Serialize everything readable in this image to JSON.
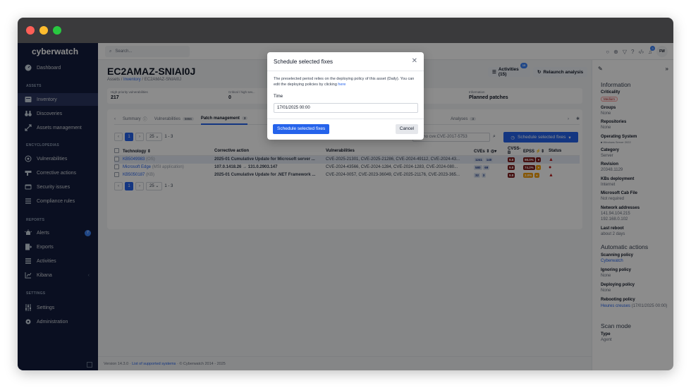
{
  "app": {
    "logo": "cyberwatch",
    "search_placeholder": "Search...",
    "avatar_initials": "FW",
    "notif_count": "3"
  },
  "sidebar": {
    "dashboard": "Dashboard",
    "assets_section": "ASSETS",
    "inventory": "Inventory",
    "discoveries": "Discoveries",
    "assets_management": "Assets management",
    "encyclopedias_section": "ENCYCLOPEDIAS",
    "vulnerabilities": "Vulnerabilities",
    "corrective_actions": "Corrective actions",
    "security_issues": "Security issues",
    "compliance_rules": "Compliance rules",
    "reports_section": "REPORTS",
    "alerts": "Alerts",
    "alerts_count": "7",
    "exports": "Exports",
    "activities": "Activities",
    "kibana": "Kibana",
    "settings_section": "SETTINGS",
    "settings": "Settings",
    "administration": "Administration"
  },
  "page": {
    "title": "EC2AMAZ-SNIAI0J",
    "breadcrumb_assets": "Assets",
    "breadcrumb_inventory": "Inventory",
    "breadcrumb_current": "EC2AMAZ-SNIAI0J",
    "activities_label": "Activities (15)",
    "activities_badge": "15",
    "relaunch_label": "Relaunch analysis"
  },
  "summary": {
    "high_priority_label": "High-priority vulnerabilities",
    "high_priority_value": "217",
    "critical_label": "Critical / high sev...",
    "critical_value": "0",
    "info_label": "Information",
    "info_value": "Planned patches"
  },
  "tabs": {
    "summary": "Summary",
    "vulnerabilities": "Vulnerabilities",
    "vulnerabilities_count": "5866",
    "patch": "Patch management",
    "patch_count": "3",
    "analyses": "Analyses",
    "analyses_count": "3"
  },
  "pager": {
    "page": "1",
    "per_page": "25",
    "range": "1 - 3"
  },
  "filter": {
    "value": "techno cve:CVE-2017-5753",
    "schedule_label": "Schedule selected fixes"
  },
  "table": {
    "headers": {
      "technology": "Technology",
      "corrective_action": "Corrective action",
      "vulnerabilities": "Vulnerabilities",
      "cves": "CVEs",
      "cvss": "CVSS-B",
      "epss": "EPSS",
      "status": "Status"
    },
    "rows": [
      {
        "tech": "KB5049983",
        "tech_sub": "(OS)",
        "action": "2025-01 Cumulative Update for Microsoft server ...",
        "vulns": "CVE-2025-21301, CVE-2025-21286, CVE-2024-49112, CVE-2024-43...",
        "cves": "1241",
        "prio": "140",
        "cvss": "9.8",
        "epss": "98.0%"
      },
      {
        "tech": "Microsoft Edge",
        "tech_sub": "(MSI application)",
        "action": "107.0.1418.26 → 131.0.2903.147",
        "vulns": "CVE-2024-43566, CVE-2024-1284, CVE-2024-1283, CVE-2024-080...",
        "cves": "580",
        "prio": "69",
        "cvss": "9.8",
        "epss": "74.2%"
      },
      {
        "tech": "KB5050187",
        "tech_sub": "(KB)",
        "action": "2025-01 Cumulative Update for .NET Framework ...",
        "vulns": "CVE-2024-0057, CVE-2023-36049, CVE-2025-21176, CVE-2023-365...",
        "cves": "32",
        "prio": "3",
        "cvss": "9.8",
        "epss": "2.0%"
      }
    ]
  },
  "right_panel": {
    "information": "Information",
    "criticality": "Criticality",
    "criticality_value": "Medium",
    "groups": "Groups",
    "groups_value": "None",
    "repositories": "Repositories",
    "repositories_value": "None",
    "os": "Operating System",
    "os_value": "Windows Server 2022",
    "category": "Category",
    "category_value": "Server",
    "revision": "Revision",
    "revision_value": "20348.1129",
    "kbs": "KBs deployment",
    "kbs_value": "Internet",
    "cab": "Microsoft Cab File",
    "cab_value": "Not required",
    "network": "Network addresses",
    "network_value_1": "141.94.104.215",
    "network_value_2": "192.168.0.102",
    "last_reboot": "Last reboot",
    "last_reboot_value": "about 2 days",
    "automatic_actions": "Automatic actions",
    "scanning": "Scanning policy",
    "scanning_value": "Cyberwatch",
    "ignoring": "Ignoring policy",
    "ignoring_value": "None",
    "deploying": "Deploying policy",
    "deploying_value": "None",
    "rebooting": "Rebooting policy",
    "rebooting_value_link": "Heures creuses",
    "rebooting_value_rest": " (17/01/2025 00:00)",
    "scan_mode": "Scan mode",
    "type": "Type",
    "type_value": "Agent"
  },
  "footer": {
    "version": "Version 14.3.0",
    "supported": "List of supported systems",
    "copyright": "© Cyberwatch 2014 - 2025"
  },
  "modal": {
    "title": "Schedule selected fixes",
    "text": "The preselected period relies on the deploying policy of this asset (Daily). You can edit the deploying policies by clicking ",
    "text_link": "here",
    "time_label": "Time",
    "time_value": "17/01/2025 00:00",
    "confirm": "Schedule selected fixes",
    "cancel": "Cancel"
  }
}
